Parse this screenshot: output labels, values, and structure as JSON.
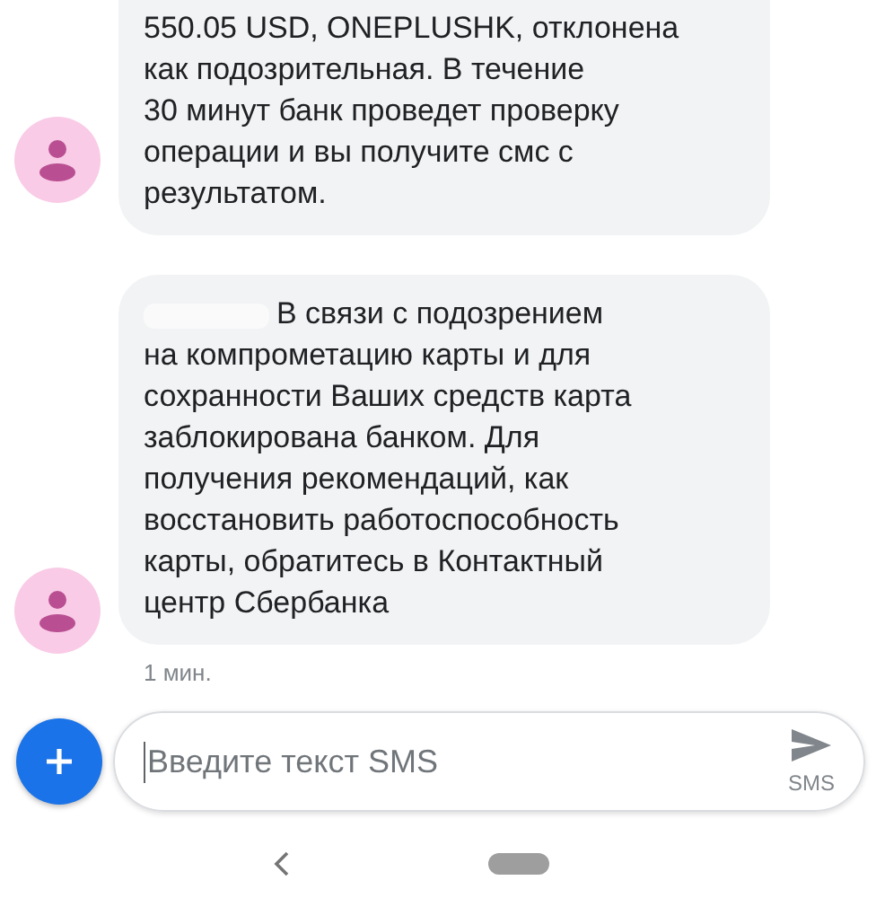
{
  "messages": [
    {
      "lines": [
        "550.05 USD, ONEPLUSHK, отклонена",
        "как подозрительная. В течение",
        "30 минут банк проведет проверку",
        "операции и вы получите смс с",
        "результатом."
      ],
      "redacted": false,
      "cut_top": true
    },
    {
      "lines": [
        "В связи с подозрением",
        "на компрометацию карты и для",
        "сохранности Ваших средств карта",
        "заблокирована банком. Для",
        "получения рекомендаций, как",
        "восстановить работоспособность",
        "карты, обратитесь в Контактный",
        "центр Сбербанка"
      ],
      "redacted": true,
      "cut_top": false,
      "time": "1 мин."
    }
  ],
  "compose": {
    "placeholder": "Введите текст SMS",
    "send_label": "SMS"
  }
}
